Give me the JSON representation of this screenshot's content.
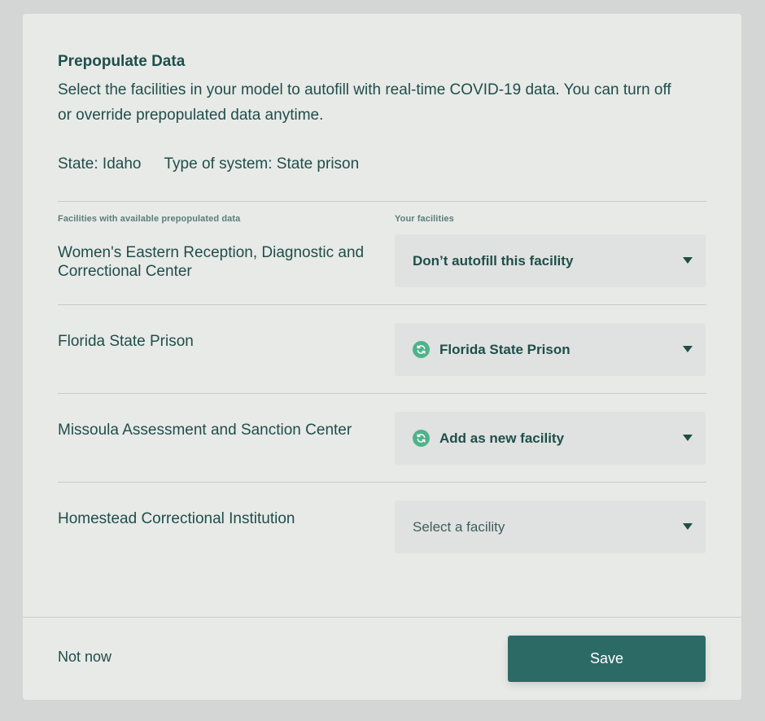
{
  "modal": {
    "title": "Prepopulate Data",
    "description": "Select the facilities in your model to autofill with real-time COVID-19 data. You can turn off or override prepopulated data anytime.",
    "state": "State: Idaho",
    "system_type": "Type of system: State prison",
    "col_left": "Facilities with available prepopulated data",
    "col_right": "Your facilities",
    "rows": [
      {
        "name": "Women's Eastern Reception, Diagnostic and Correctional Center",
        "selection": "Don’t autofill this facility",
        "icon": "none"
      },
      {
        "name": "Florida State Prison",
        "selection": "Florida State Prison",
        "icon": "sync-icon"
      },
      {
        "name": "Missoula Assessment and Sanction Center",
        "selection": "Add as new facility",
        "icon": "sync-icon"
      },
      {
        "name": "Homestead Correctional Institution",
        "selection": "Select a facility",
        "icon": "none"
      }
    ],
    "not_now_label": "Not now",
    "save_label": "Save"
  },
  "colors": {
    "accent": "#2c6a66",
    "sync_icon": "#4fb38a",
    "text": "#1f4e4a",
    "background": "#e8eae8"
  }
}
